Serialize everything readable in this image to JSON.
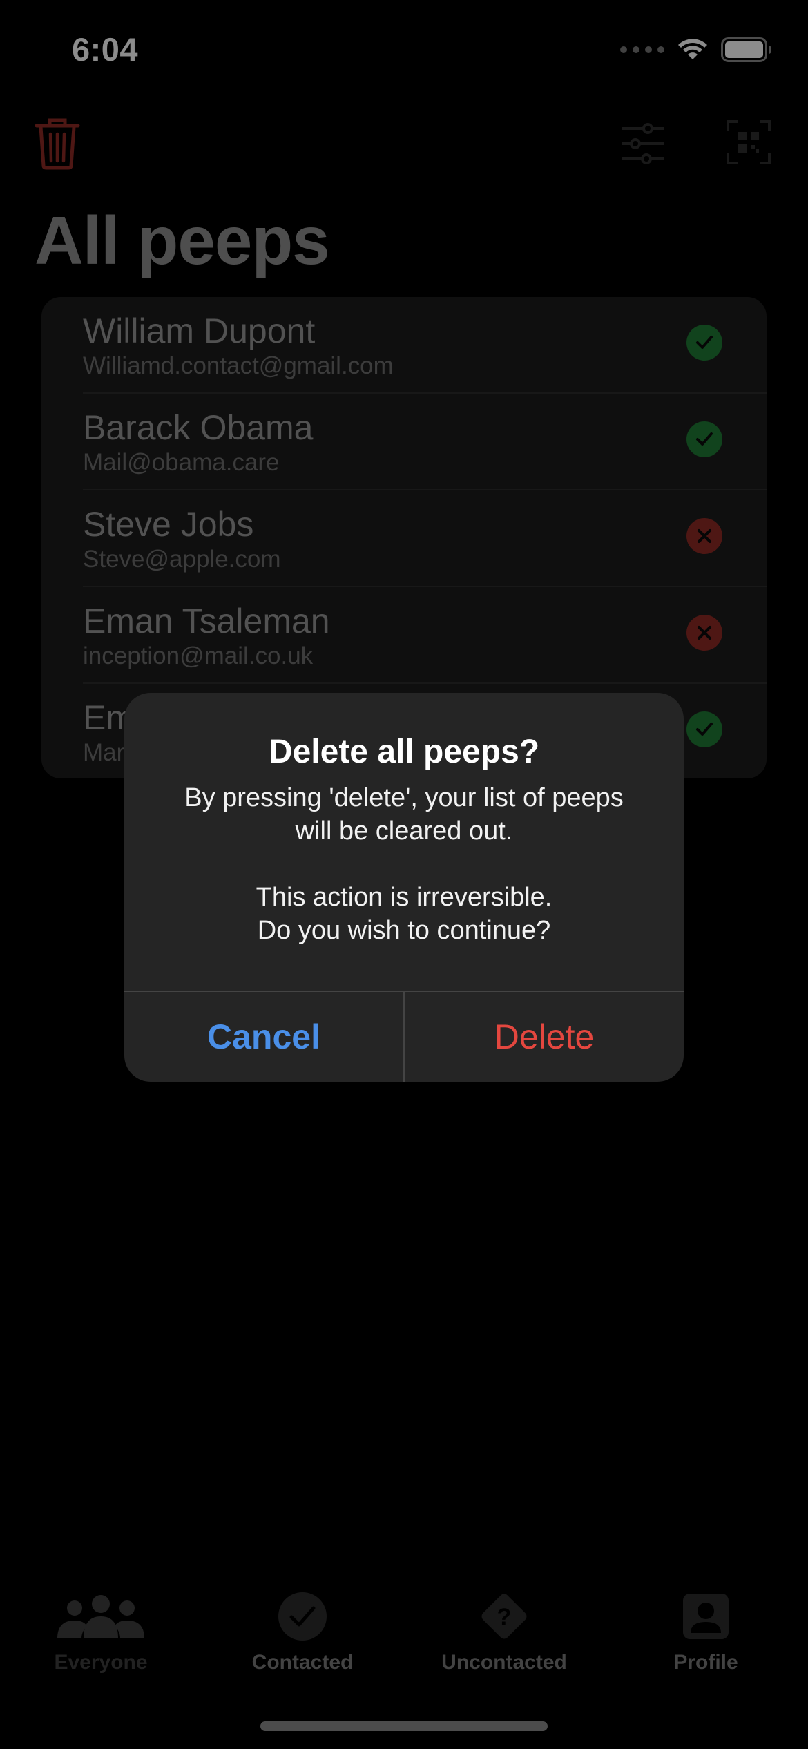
{
  "status_bar": {
    "time": "6:04"
  },
  "toolbar": {
    "trash_icon": "trash-icon",
    "filter_icon": "sliders-icon",
    "qr_icon": "qr-scan-icon"
  },
  "page_title": "All peeps",
  "contacts": [
    {
      "name": "William Dupont",
      "email": "Williamd.contact@gmail.com",
      "status": "contacted"
    },
    {
      "name": "Barack Obama",
      "email": "Mail@obama.care",
      "status": "contacted"
    },
    {
      "name": "Steve Jobs",
      "email": "Steve@apple.com",
      "status": "uncontacted"
    },
    {
      "name": "Eman Tsaleman",
      "email": "inception@mail.co.uk",
      "status": "uncontacted"
    },
    {
      "name": "Em",
      "email": "Mar",
      "status": "contacted"
    }
  ],
  "alert": {
    "title": "Delete all peeps?",
    "message_lines": [
      "By pressing 'delete', your list of peeps",
      "will be cleared out.",
      "",
      "This action is irreversible.",
      "Do you wish to continue?"
    ],
    "cancel_label": "Cancel",
    "delete_label": "Delete"
  },
  "tabs": [
    {
      "label": "Everyone",
      "icon": "people-icon"
    },
    {
      "label": "Contacted",
      "icon": "checkmark-circle-icon"
    },
    {
      "label": "Uncontacted",
      "icon": "question-diamond-icon"
    },
    {
      "label": "Profile",
      "icon": "person-square-icon"
    }
  ],
  "colors": {
    "accent_blue": "#4a8fe8",
    "destructive_red": "#e4473f",
    "contacted_green": "#1f7a35",
    "uncontacted_red": "#8e2a25"
  }
}
